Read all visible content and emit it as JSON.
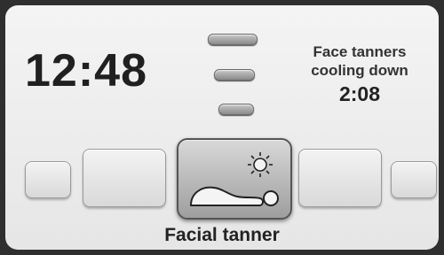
{
  "clock": {
    "time": "12:48"
  },
  "cooldown": {
    "line1": "Face tanners",
    "line2": "cooling down",
    "remaining": "2:08"
  },
  "carousel": {
    "selected_index": 2,
    "items": [
      {
        "name": "tile-far-left",
        "label": ""
      },
      {
        "name": "tile-near-left",
        "label": ""
      },
      {
        "name": "facial-tanner",
        "label": "Facial tanner",
        "icon": "facial-tanner-icon"
      },
      {
        "name": "tile-near-right",
        "label": ""
      },
      {
        "name": "tile-far-right",
        "label": ""
      }
    ]
  },
  "caption": "Facial tanner",
  "colors": {
    "bezel": "#2f2f2f",
    "panel": "#eeeeee",
    "text": "#222222"
  }
}
